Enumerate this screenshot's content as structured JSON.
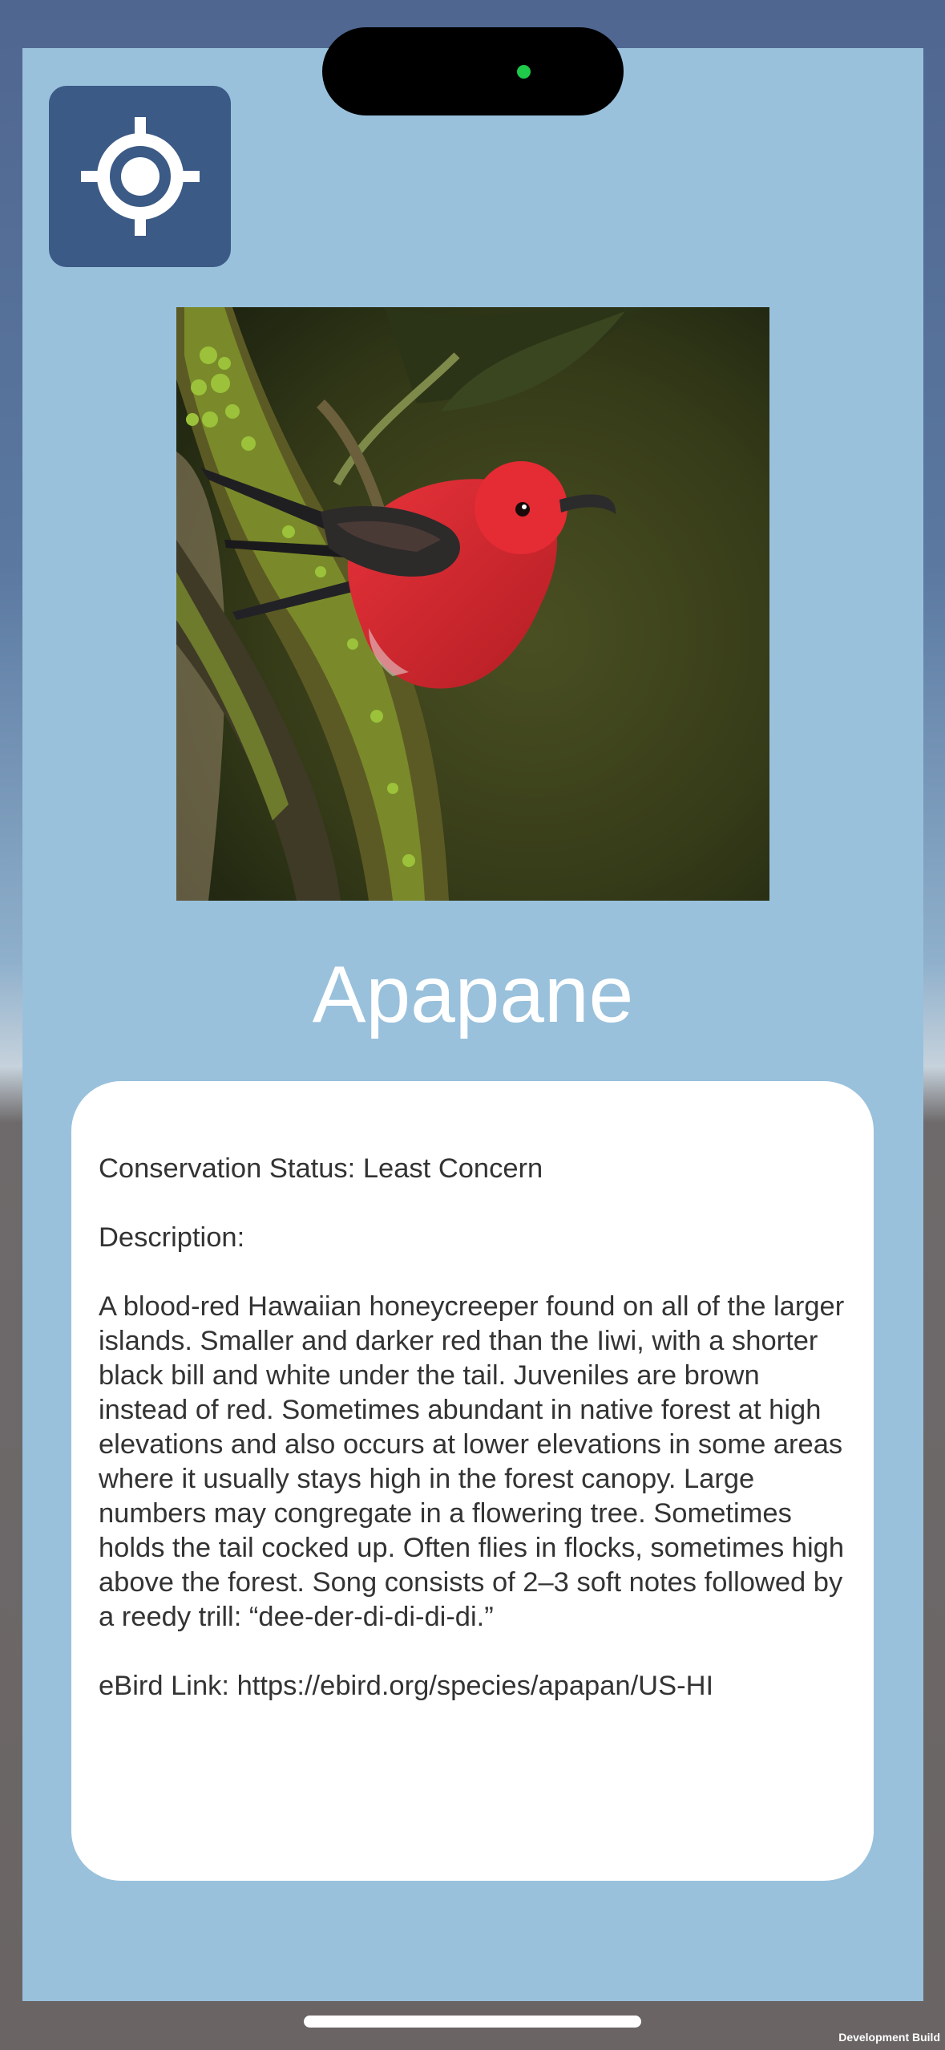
{
  "icons": {
    "locate": "crosshair-location-icon"
  },
  "bird": {
    "name": "Apapane",
    "photo_alt": "Apapane"
  },
  "info": {
    "conservation_status": "Conservation Status: Least Concern",
    "description_label": "Description:",
    "description": "A blood-red Hawaiian honeycreeper found on all of the larger islands. Smaller and darker red than the Iiwi, with a shorter black bill and white under the tail. Juveniles are brown instead of red. Sometimes abundant in native forest at high elevations and also occurs at lower elevations in some areas where it usually stays high in the forest canopy. Large numbers may congregate in a flowering tree. Sometimes holds the tail cocked up. Often flies in flocks, sometimes high above the forest. Song consists of 2–3 soft notes followed by a reedy trill: “dee-der-di-di-di-di.”",
    "ebird_link": "eBird Link: https://ebird.org/species/apapan/US-HI"
  },
  "footer": {
    "build_label": "Development Build"
  },
  "colors": {
    "panel": "#99c1dc",
    "button": "#3b5a85",
    "card": "#ffffff",
    "title": "#ffffff",
    "body_text": "#333333",
    "bird_red": "#d8262c"
  }
}
